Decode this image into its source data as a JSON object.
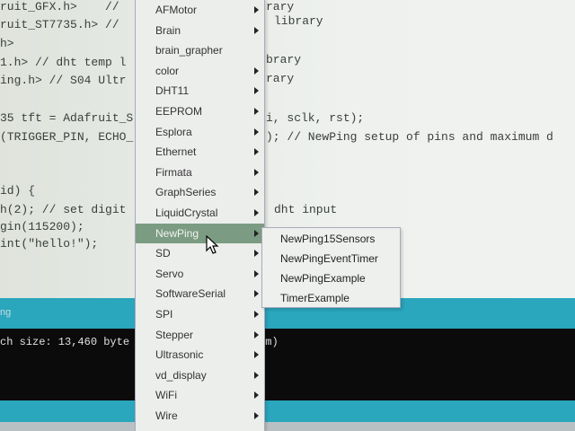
{
  "editor": {
    "left_lines": [
      "ruit_GFX.h>    //",
      "ruit_ST7735.h> //",
      "h>",
      "1.h> // dht temp l",
      "ing.h> // S04 Ultr",
      "35 tft = Adafruit_S",
      "(TRIGGER_PIN, ECHO_",
      "id) {",
      "h(2); // set digit",
      "gin(115200);",
      "int(\"hello!\");"
    ],
    "right_lines": [
      "rary",
      "library",
      "brary",
      "rary",
      "i, sclk, rst);",
      "); // NewPing setup of pins and maximum d",
      "dht input"
    ]
  },
  "status_text": "ng",
  "console_text": "ch size: 13,460 byte            te maximum)",
  "menu": {
    "items": [
      {
        "label": "AFMotor",
        "sub": true
      },
      {
        "label": "Brain",
        "sub": true
      },
      {
        "label": "brain_grapher",
        "sub": false
      },
      {
        "label": "color",
        "sub": true
      },
      {
        "label": "DHT11",
        "sub": true
      },
      {
        "label": "EEPROM",
        "sub": true
      },
      {
        "label": "Esplora",
        "sub": true
      },
      {
        "label": "Ethernet",
        "sub": true
      },
      {
        "label": "Firmata",
        "sub": true
      },
      {
        "label": "GraphSeries",
        "sub": true
      },
      {
        "label": "LiquidCrystal",
        "sub": true
      },
      {
        "label": "NewPing",
        "sub": true,
        "selected": true
      },
      {
        "label": "SD",
        "sub": true
      },
      {
        "label": "Servo",
        "sub": true
      },
      {
        "label": "SoftwareSerial",
        "sub": true
      },
      {
        "label": "SPI",
        "sub": true
      },
      {
        "label": "Stepper",
        "sub": true
      },
      {
        "label": "Ultrasonic",
        "sub": true
      },
      {
        "label": "vd_display",
        "sub": true
      },
      {
        "label": "WiFi",
        "sub": true
      },
      {
        "label": "Wire",
        "sub": true
      }
    ]
  },
  "submenu": {
    "items": [
      "NewPing15Sensors",
      "NewPingEventTimer",
      "NewPingExample",
      "TimerExample"
    ]
  }
}
